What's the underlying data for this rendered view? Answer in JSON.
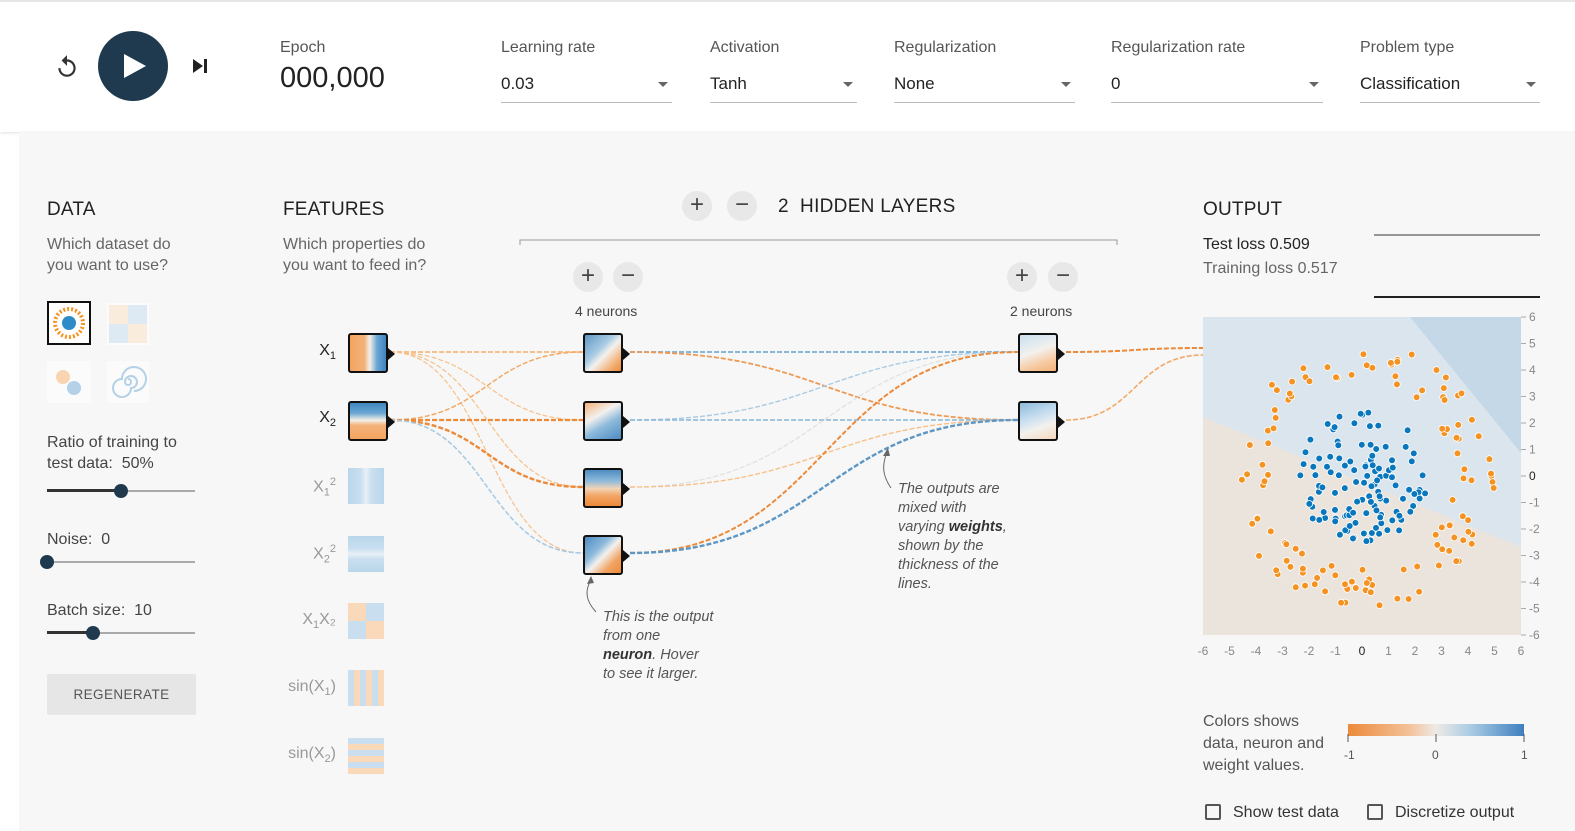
{
  "controls": {
    "epoch_label": "Epoch",
    "epoch_value": "000,000",
    "learning_rate": {
      "label": "Learning rate",
      "value": "0.03"
    },
    "activation": {
      "label": "Activation",
      "value": "Tanh"
    },
    "regularization": {
      "label": "Regularization",
      "value": "None"
    },
    "regularization_rate": {
      "label": "Regularization rate",
      "value": "0"
    },
    "problem_type": {
      "label": "Problem type",
      "value": "Classification"
    }
  },
  "data_panel": {
    "title": "DATA",
    "subtitle_line1": "Which dataset do",
    "subtitle_line2": "you want to use?",
    "ratio_label": "Ratio of training to",
    "ratio_label2": "test data:",
    "ratio_value": "50%",
    "ratio_fraction": 0.5,
    "noise_label": "Noise:",
    "noise_value": "0",
    "noise_fraction": 0.0,
    "batch_label": "Batch size:",
    "batch_value": "10",
    "batch_fraction": 0.31,
    "regenerate_label": "REGENERATE"
  },
  "features_panel": {
    "title": "FEATURES",
    "subtitle_line1": "Which properties do",
    "subtitle_line2": "you want to feed in?",
    "features": [
      {
        "base": "X",
        "sub": "1",
        "sup": "",
        "pre": "",
        "post": ""
      },
      {
        "base": "X",
        "sub": "2",
        "sup": "",
        "pre": "",
        "post": ""
      },
      {
        "base": "X",
        "sub": "1",
        "sup": "2",
        "pre": "",
        "post": ""
      },
      {
        "base": "X",
        "sub": "2",
        "sup": "2",
        "pre": "",
        "post": ""
      },
      {
        "base": "X",
        "sub": "1",
        "sup": "",
        "pre": "",
        "post": "X₂"
      },
      {
        "base": "X",
        "sub": "1",
        "sup": "",
        "pre": "sin(",
        "post": ")"
      },
      {
        "base": "X",
        "sub": "2",
        "sup": "",
        "pre": "sin(",
        "post": ")"
      }
    ]
  },
  "network": {
    "layers_count": "2",
    "layers_label": "HIDDEN LAYERS",
    "layer1_neurons": "4 neurons",
    "layer2_neurons": "2 neurons",
    "plus": "+",
    "minus": "−"
  },
  "annotations": {
    "neuron_note": [
      "This is the output",
      "from one",
      "neuron",
      ". Hover",
      "to see it larger."
    ],
    "weights_note": [
      "The outputs are",
      "mixed with",
      "varying ",
      "weights",
      ",",
      "shown by the",
      "thickness of the",
      "lines."
    ]
  },
  "output_panel": {
    "title": "OUTPUT",
    "test_loss_label": "Test loss",
    "test_loss": "0.509",
    "train_loss_label": "Training loss",
    "train_loss": "0.517",
    "colors_note_line1": "Colors shows",
    "colors_note_line2": "data, neuron and",
    "colors_note_line3": "weight values.",
    "scale_min": "-1",
    "scale_mid": "0",
    "scale_max": "1",
    "show_test_label": "Show test data",
    "discretize_label": "Discretize output"
  },
  "chart_data": {
    "type": "scatter",
    "x_range": [
      -6,
      6
    ],
    "y_range": [
      -6,
      6
    ],
    "x_ticks": [
      "-6",
      "-5",
      "-4",
      "-3",
      "-2",
      "-1",
      "0",
      "1",
      "2",
      "3",
      "4",
      "5",
      "6"
    ],
    "y_ticks": [
      "6",
      "5",
      "4",
      "3",
      "2",
      "1",
      "0",
      "-1",
      "-2",
      "-3",
      "-4",
      "-5",
      "-6"
    ],
    "series": [
      {
        "color": "#f59322",
        "description": "outer ring",
        "radius_range": [
          3.5,
          5.0
        ]
      },
      {
        "color": "#0877bd",
        "description": "inner cluster",
        "radius_range": [
          0,
          2.5
        ]
      }
    ]
  },
  "colors": {
    "orange": "#f59322",
    "blue": "#0877bd",
    "dark": "#1f3a4e"
  }
}
